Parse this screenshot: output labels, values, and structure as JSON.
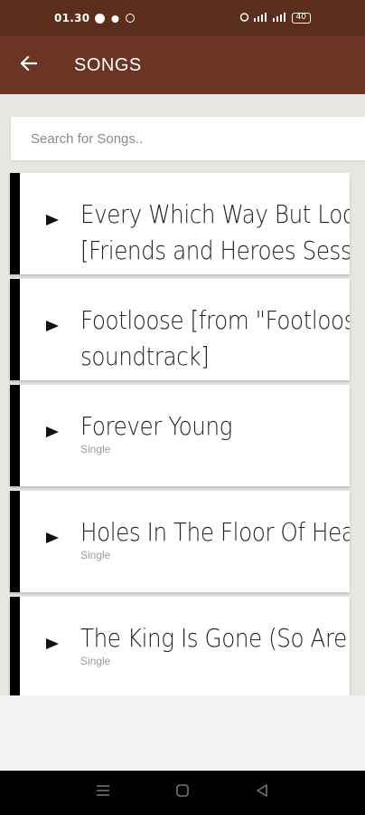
{
  "status_bar": {
    "time": "01.30",
    "battery": "40"
  },
  "app_bar": {
    "title": "SONGS"
  },
  "search": {
    "placeholder": "Search for Songs.."
  },
  "songs": [
    {
      "title_line1": "Every Which Way But Loose",
      "title_line2": "[Friends and Heroes Session]",
      "subtitle": ""
    },
    {
      "title_line1": "Footloose [from \"Footloose\"",
      "title_line2": "soundtrack]",
      "subtitle": ""
    },
    {
      "title_line1": "Forever Young",
      "title_line2": "",
      "subtitle": "Single"
    },
    {
      "title_line1": "Holes In The Floor Of Heaven",
      "title_line2": "",
      "subtitle": "Single"
    },
    {
      "title_line1": "The King Is Gone (So Are You)",
      "title_line2": "",
      "subtitle": "Single"
    }
  ],
  "colors": {
    "status_bar": "#5a2d1c",
    "app_bar": "#6b3523",
    "card_accent": "#000000"
  },
  "icons": {
    "back": "arrow-left-icon",
    "play": "play-icon",
    "nav_menu": "menu-icon",
    "nav_home": "home-icon",
    "nav_back": "back-triangle-icon"
  }
}
